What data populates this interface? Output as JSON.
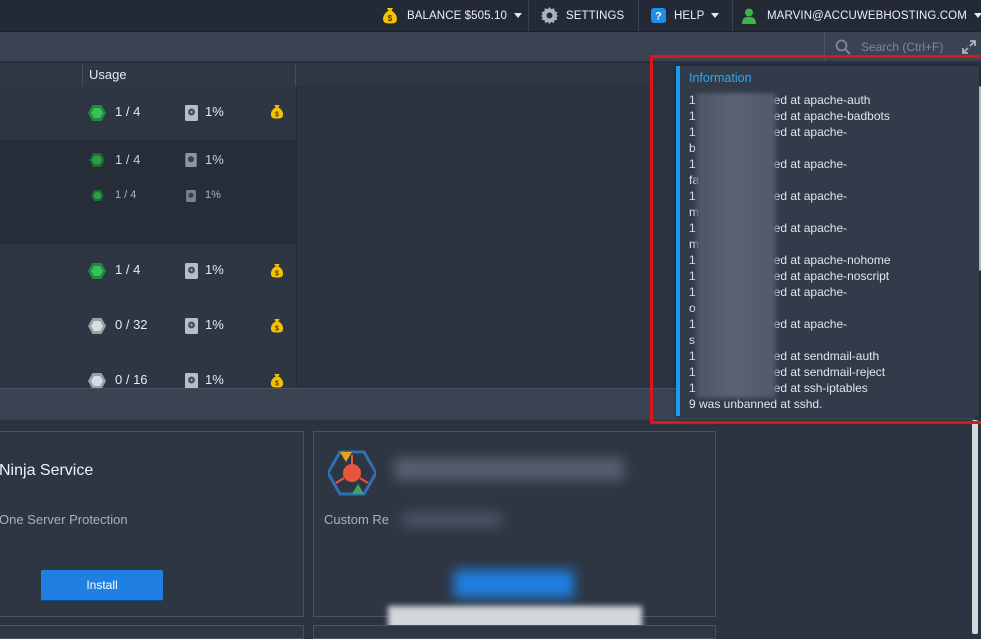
{
  "topbar": {
    "balance": "BALANCE $505.10",
    "settings": "SETTINGS",
    "help": "HELP",
    "user": "MARVIN@ACCUWEBHOSTING.COM"
  },
  "search": {
    "placeholder": "Search (Ctrl+F)"
  },
  "table": {
    "usage_header": "Usage",
    "rows": [
      {
        "cloudlets": "1 / 4",
        "disk": "1%"
      },
      {
        "cloudlets": "1 / 4",
        "disk": "1%"
      },
      {
        "cloudlets": "1 / 4",
        "disk": "1%"
      },
      {
        "cloudlets": "1 / 4",
        "disk": "1%"
      },
      {
        "cloudlets": "0 / 32",
        "disk": "1%"
      },
      {
        "cloudlets": "0 / 16",
        "disk": "1%"
      }
    ]
  },
  "marketplace": {
    "card1_title": "Ninja Service",
    "card1_subtitle": "One Server Protection",
    "card1_button": "Install",
    "card2_subtitle": "Custom Re"
  },
  "notification": {
    "title": "Information",
    "lines": [
      "1                   9 was unbanned at apache-auth",
      "1                   9 was unbanned at apache-badbots",
      "1                   9 was unbanned at apache-",
      "b",
      "1                   9 was unbanned at apache-",
      "fa",
      "1                   9 was unbanned at apache-",
      "m",
      "1                   9 was unbanned at apache-",
      "m",
      "1                   9 was unbanned at apache-nohome",
      "1                   9 was unbanned at apache-noscript",
      "1                   9 was unbanned at apache-",
      "o",
      "1                   9 was unbanned at apache-",
      "s",
      "1                   9 was unbanned at sendmail-auth",
      "1                   9 was unbanned at sendmail-reject",
      "1                   9 was unbanned at ssh-iptables",
      "                    9 was unbanned at sshd."
    ]
  },
  "colors": {
    "accent": "#1d9bf0",
    "highlight": "#e0141b",
    "cloudlet_green": "#1fa84a",
    "coin_yellow": "#f3c300",
    "button_blue": "#1f7fe3"
  },
  "icons": [
    "money-bag-icon",
    "gear-icon",
    "help-icon",
    "user-icon",
    "search-icon",
    "expand-icon",
    "cloudlet-icon",
    "disk-icon"
  ]
}
